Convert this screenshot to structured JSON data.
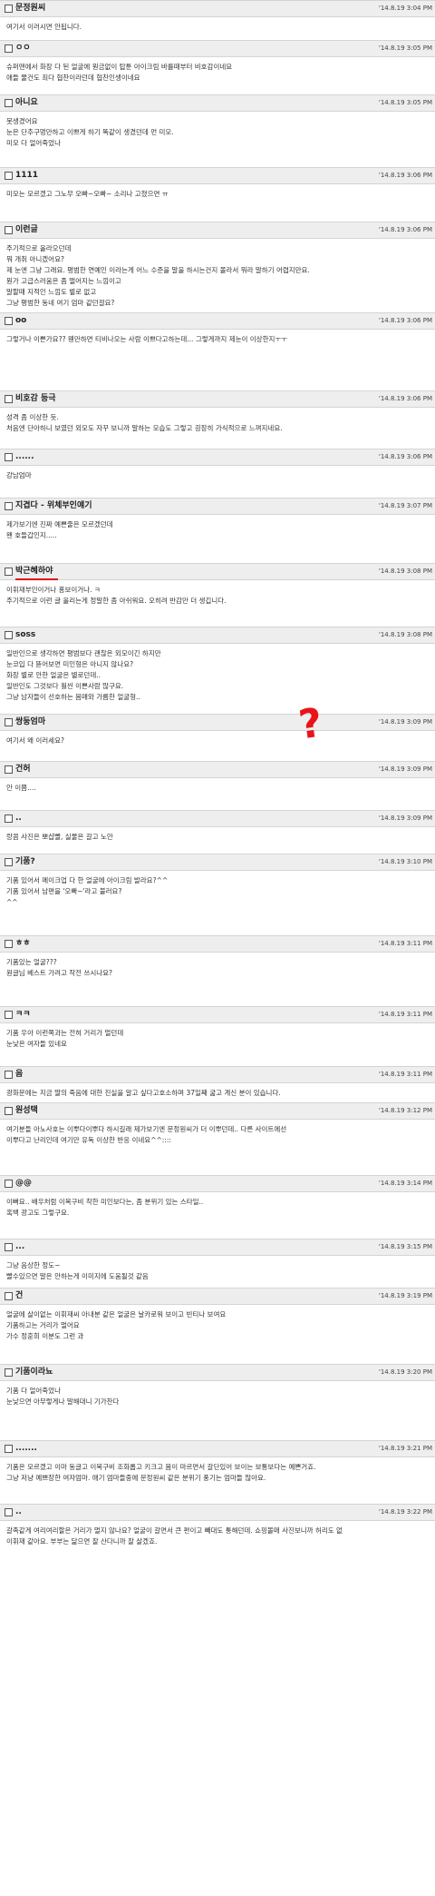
{
  "comments": [
    {
      "author": "문정원씨",
      "date": "'14.8.19 3:04 PM",
      "lines": [
        "여기서 이러시면 안됩니다."
      ]
    },
    {
      "author": "ㅇㅇ",
      "date": "'14.8.19 3:05 PM",
      "lines": [
        "슈퍼맨에서 화장 다 된 얼굴에 뭔금없이 탑툰 아이크림 바를때부터 비호감이네요",
        "애들 물건도 죄다 협찬이라던데 협찬인생이네요"
      ]
    },
    {
      "author": "아니요",
      "date": "'14.8.19 3:05 PM",
      "lines": [
        "못생겼어요",
        "눈은 단추구멍만하고 이쁘게 하기 똑같이 생겼던데 먼 미모.",
        "미모 다 얼어죽었나"
      ]
    },
    {
      "author": "1111",
      "date": "'14.8.19 3:06 PM",
      "lines": [
        "미모는 모르겠고 그노무 오빠~오빠~ 소리나 고쳤으면 ㅠ"
      ]
    },
    {
      "author": "이런글",
      "date": "'14.8.19 3:06 PM",
      "lines": [
        "주기적으로 올라오던데",
        "뭐 개취 아니겠어요?",
        "제 눈엔 그냥 그래요. 평범한 연예인 이라는게 어느 수준을 말을 하시는건지 몰라서 뭐라 말하기 어렵지만요.",
        "뭔가 고급스러움은 좀 떨어지는 느낌이고",
        "말할때 지적인 느낌도 별로 없고",
        "그냥 평범한 동네 여기 엄마 같던걸요?"
      ]
    },
    {
      "author": "oo",
      "date": "'14.8.19 3:06 PM",
      "lines": [
        "그렇거나 이쁜가요?? 웬만하면 티비나오는 사람 이쁘다고하는데... 그렇게까지 제눈이 이상한지ㅜㅜ"
      ]
    },
    {
      "author": "비호감 등극",
      "date": "'14.8.19 3:06 PM",
      "lines": [
        "성격 좀 이상한 듯.",
        "처음엔 단아하니 보였던 외모도 자꾸 보니까 말하는 모습도 그렇고 굉장히 가식적으로 느껴지네요."
      ]
    },
    {
      "author": "......",
      "date": "'14.8.19 3:06 PM",
      "lines": [
        "강남엄마"
      ]
    },
    {
      "author": "지겹다 - 위체부인얘기",
      "date": "'14.8.19 3:07 PM",
      "lines": [
        "제가보기엔 진짜 예쁜줄은 모르겠던데",
        "왠 호들갑인지....."
      ]
    },
    {
      "author": "박근혜하야",
      "date": "'14.8.19 3:08 PM",
      "lines": [
        "이휘재부인이거나 홍보이거나. ㅋ",
        "주기적으로 이런 글 올리는게 정말한 좀 아쉬워요. 오히려 반감만 더 생깁니다."
      ]
    },
    {
      "author": "soss",
      "date": "'14.8.19 3:08 PM",
      "lines": [
        "일반인으로 생각하면 평범보다 괜찮은 외모이긴 하지만",
        "눈코입 다 뜯어보면 미인형은 아니지 않나요?",
        "화장 별로 안한 얼굴은 별로던데..",
        "일반인도 그것보다 훨씬 이쁜사람 많구요.",
        "그냥 남자들이 선호하는 몸매와 가름한 얼굴형.."
      ]
    },
    {
      "author": "쌍둥엄마",
      "date": "'14.8.19 3:09 PM",
      "lines": [
        "여기서 왜 이러세요?"
      ]
    },
    {
      "author": "건허",
      "date": "'14.8.19 3:09 PM",
      "lines": [
        "안 이쁨...."
      ]
    },
    {
      "author": "..",
      "date": "'14.8.19 3:09 PM",
      "lines": [
        "랑콤 사진은 뽀샵빨, 실물은 갈고 노안"
      ]
    },
    {
      "author": "기품?",
      "date": "'14.8.19 3:10 PM",
      "lines": [
        "기품 있어서 메이크업 다 한 얼굴에 아이크림 발라요?^^",
        "기품 있어서 남편을 '오빠~'라고 불러요?",
        "^^"
      ]
    },
    {
      "author": "ㅎㅎ",
      "date": "'14.8.19 3:11 PM",
      "lines": [
        "기품있는 얼굴???",
        "원글님 베스트 가려고 작전 쓰시나요?"
      ]
    },
    {
      "author": "ㅋㅋ",
      "date": "'14.8.19 3:11 PM",
      "lines": [
        "기품 우아 이런쪽과는 전혀 거리가 멀던데",
        "눈낮은 여자들 있네요"
      ]
    },
    {
      "author": "음",
      "date": "'14.8.19 3:11 PM",
      "lines": [
        "광화문에는 지금 딸의 죽음에 대한 진실을 알고 싶다고호소하며 37일째 굶고 계신 분이 있습니다."
      ]
    },
    {
      "author": "원성택",
      "date": "'14.8.19 3:12 PM",
      "lines": [
        "여기분들 아노사호는 이뿌다이뿌다 하시길래 제가보기엔 문정원씨가 더 이뿌던데.. 다른 사이트에선",
        "",
        "이뿌다고 난리인데 여기만 유독 이상한 반응 이네요^^::::"
      ]
    },
    {
      "author": "@@",
      "date": "'14.8.19 3:14 PM",
      "lines": [
        "이뻐요.. 배우처럼 이목구비 착한 미인보다는, 좀 분위기 있는 스타일..",
        "",
        "혹백 광고도 그렇구요."
      ]
    },
    {
      "author": "...",
      "date": "'14.8.19 3:15 PM",
      "lines": [
        "그냥 음상한 정도~",
        "빨수있으면 말은 안하는게 이미지에 도움될것 같음"
      ]
    },
    {
      "author": "건",
      "date": "'14.8.19 3:19 PM",
      "lines": [
        "얼굴에 살이없는 이휘재씨 아내분 같은 얼굴은 날카로워 보이고 빈티나 보여요",
        "기품하고는 거리가 멀어요",
        "가수 정훈희 이분도 그런 과"
      ]
    },
    {
      "author": "기품이라뇨",
      "date": "'14.8.19 3:20 PM",
      "lines": [
        "기품 다 얼어죽었나",
        "눈낮으면 아무렇게나 말해대니 기가찬다"
      ]
    },
    {
      "author": ".......",
      "date": "'14.8.19 3:21 PM",
      "lines": [
        "기품은 모르겠고 이마 동글고 이목구비 조화롭고 키크고 몸이 마르면서 갈단있어 보이는 보통보다는 예쁜거죠.",
        "그냥 저냥 예쁘장한 여자엄마. 애기 엄마들중에 문정원씨 같은 분위기 풍기는 엄마들 많아요."
      ]
    },
    {
      "author": "..",
      "date": "'14.8.19 3:22 PM",
      "lines": [
        "갈족같게 여리여리할은 거리가 멀지 않나요? 얼굴이 갈면서 큰 편이고 빼대도 통해던데. 쇼핑몰매 사진보니까 허리도 없",
        "이휘재 같아요. 부부는 닮으면 잘 산다니까 잘 살겠죠."
      ]
    }
  ],
  "annotation": {
    "mark": "?",
    "color": "#e8141a"
  }
}
